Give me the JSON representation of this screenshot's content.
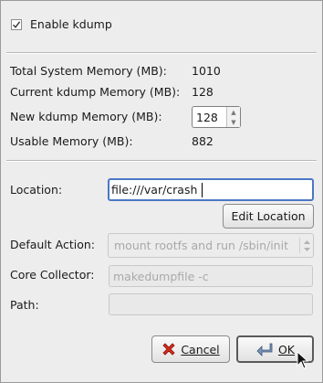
{
  "enable_kdump": {
    "label": "Enable kdump",
    "checked": true
  },
  "memory": {
    "total_label": "Total System Memory (MB):",
    "total_value": "1010",
    "current_label": "Current kdump Memory (MB):",
    "current_value": "128",
    "new_label": "New kdump Memory (MB):",
    "new_value": "128",
    "usable_label": "Usable Memory (MB):",
    "usable_value": "882"
  },
  "location": {
    "label": "Location:",
    "value": "file:///var/crash",
    "edit_button": "Edit Location"
  },
  "default_action": {
    "label": "Default Action:",
    "value": "mount rootfs and run /sbin/init"
  },
  "core_collector": {
    "label": "Core Collector:",
    "placeholder": "makedumpfile -c"
  },
  "path": {
    "label": "Path:",
    "value": ""
  },
  "buttons": {
    "cancel": "Cancel",
    "ok": "OK"
  }
}
